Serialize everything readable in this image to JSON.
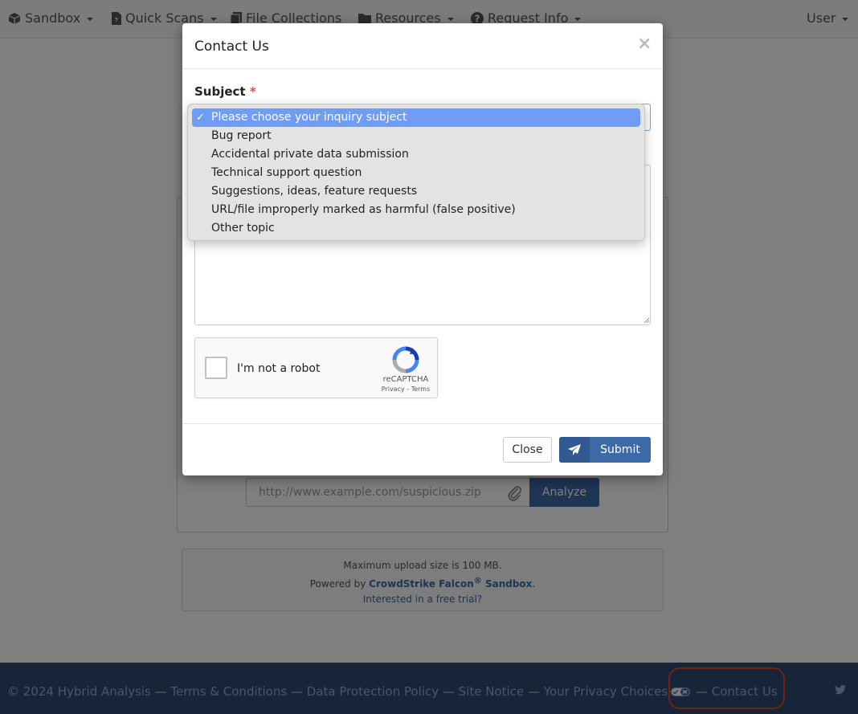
{
  "navbar": {
    "items": [
      {
        "label": "Sandbox",
        "icon": "cube-icon"
      },
      {
        "label": "Quick Scans",
        "icon": "file-bolt-icon"
      },
      {
        "label": "File Collections",
        "icon": "files-icon"
      },
      {
        "label": "Resources",
        "icon": "folder-icon"
      },
      {
        "label": "Request Info",
        "icon": "question-circle-icon"
      }
    ],
    "user_label": "User"
  },
  "main": {
    "url_placeholder": "http://www.example.com/suspicious.zip",
    "analyze_label": "Analyze"
  },
  "info": {
    "upload_limit": "Maximum upload size is 100 MB.",
    "powered_by_prefix": "Powered by ",
    "powered_by_link": "CrowdStrike Falcon",
    "powered_by_reg": "®",
    "powered_by_suffix_link": " Sandbox",
    "powered_by_end": ".",
    "trial_link": "Interested in a free trial?"
  },
  "footer": {
    "copyright": "© 2024 Hybrid Analysis",
    "separator": " — ",
    "links": [
      "Terms & Conditions",
      "Data Protection Policy",
      "Site Notice",
      "Your Privacy Choices",
      "Contact Us"
    ]
  },
  "modal": {
    "title": "Contact Us",
    "close_symbol": "×",
    "subject_label": "Subject",
    "required_mark": "*",
    "subject_options": [
      "Please choose your inquiry subject",
      "Bug report",
      "Accidental private data submission",
      "Technical support question",
      "Suggestions, ideas, feature requests",
      "URL/file improperly marked as harmful (false positive)",
      "Other topic"
    ],
    "selected_index": 0,
    "check_mark": "✓",
    "recaptcha": {
      "label": "I'm not a robot",
      "brand": "reCAPTCHA",
      "links": "Privacy - Terms"
    },
    "close_button": "Close",
    "submit_button": "Submit"
  },
  "colors": {
    "primary": "#3c6aa6",
    "footer_bg": "#2c4a6e",
    "highlight": "#e2462a",
    "selected_option": "#6f9cf5"
  }
}
